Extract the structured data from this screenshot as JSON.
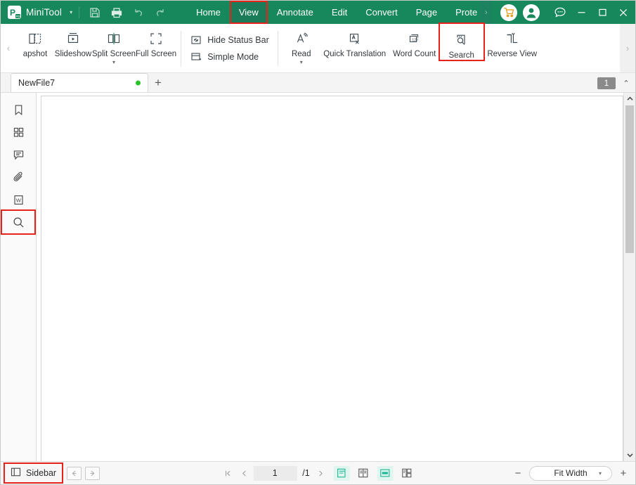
{
  "titlebar": {
    "brand": "MiniTool",
    "brand_caret": "▾",
    "quick_actions": [
      {
        "name": "save-icon",
        "label": "Save"
      },
      {
        "name": "print-icon",
        "label": "Print"
      },
      {
        "name": "undo-icon",
        "label": "Undo"
      },
      {
        "name": "redo-icon",
        "label": "Redo"
      }
    ],
    "tabs": [
      {
        "label": "Home",
        "active": false
      },
      {
        "label": "View",
        "active": true,
        "highlighted": true
      },
      {
        "label": "Annotate",
        "active": false
      },
      {
        "label": "Edit",
        "active": false
      },
      {
        "label": "Convert",
        "active": false
      },
      {
        "label": "Page",
        "active": false
      },
      {
        "label": "Prote",
        "active": false
      }
    ],
    "tabs_overflow": "›",
    "cart_label": "Cart",
    "account_label": "Account",
    "feedback_label": "Feedback",
    "minimize": "—",
    "maximize": "▢",
    "close": "✕"
  },
  "ribbon": {
    "scroll_left": "‹",
    "scroll_right": "›",
    "buttons": [
      {
        "label": "apshot",
        "icon": "snapshot-icon",
        "caret": null,
        "highlighted": false
      },
      {
        "label": "Slideshow",
        "icon": "slideshow-icon",
        "caret": null,
        "highlighted": false
      },
      {
        "label": "Split Screen",
        "icon": "split-screen-icon",
        "caret": "▾",
        "highlighted": false
      },
      {
        "label": "Full Screen",
        "icon": "full-screen-icon",
        "caret": null,
        "highlighted": false
      }
    ],
    "toggles": [
      {
        "label": "Hide Status Bar",
        "icon": "hide-status-bar-icon"
      },
      {
        "label": "Simple Mode",
        "icon": "simple-mode-icon"
      }
    ],
    "buttons2": [
      {
        "label": "Read",
        "icon": "read-aloud-icon",
        "caret": "▾",
        "highlighted": false
      },
      {
        "label": "Quick Translation",
        "icon": "quick-translation-icon",
        "caret": null,
        "highlighted": false
      },
      {
        "label": "Word Count",
        "icon": "word-count-icon",
        "caret": null,
        "highlighted": false
      },
      {
        "label": "Search",
        "icon": "search-icon",
        "caret": null,
        "highlighted": true
      },
      {
        "label": "Reverse View",
        "icon": "reverse-view-icon",
        "caret": null,
        "highlighted": false
      }
    ]
  },
  "tabstrip": {
    "document_tab": "NewFile7",
    "modified_dot": true,
    "new_tab": "+",
    "page_badge": "1",
    "collapse": "⌃"
  },
  "sidebar": {
    "items": [
      {
        "name": "bookmark-icon",
        "label": "Bookmarks",
        "highlighted": false
      },
      {
        "name": "thumbnails-icon",
        "label": "Thumbnails",
        "highlighted": false
      },
      {
        "name": "comment-icon",
        "label": "Comments",
        "highlighted": false
      },
      {
        "name": "attachment-icon",
        "label": "Attachments",
        "highlighted": false
      },
      {
        "name": "word-icon",
        "label": "Word",
        "highlighted": false
      },
      {
        "name": "search-icon",
        "label": "Search",
        "highlighted": true
      }
    ]
  },
  "statusbar": {
    "sidebar_toggle": "Sidebar",
    "nav_back": "←",
    "nav_forward": "→",
    "page_first": "|‹",
    "page_prev": "‹",
    "page_current": "1",
    "page_total": "/1",
    "page_next": "›",
    "view_modes": [
      {
        "name": "single-page-view-icon",
        "active": true
      },
      {
        "name": "two-page-view-icon",
        "active": false
      },
      {
        "name": "continuous-scroll-view-icon",
        "active": true
      },
      {
        "name": "thumbnail-grid-view-icon",
        "active": false
      }
    ],
    "zoom_out": "−",
    "zoom_level": "Fit Width",
    "zoom_caret": "▾",
    "zoom_in": "+"
  },
  "colors": {
    "brand_green": "#17875c",
    "tab_active_green": "#1e7d5a",
    "highlight_red": "#e8211a",
    "accent_teal": "#1fb894",
    "modified_dot": "#28c328",
    "badge_gray": "#8a8a8a"
  }
}
